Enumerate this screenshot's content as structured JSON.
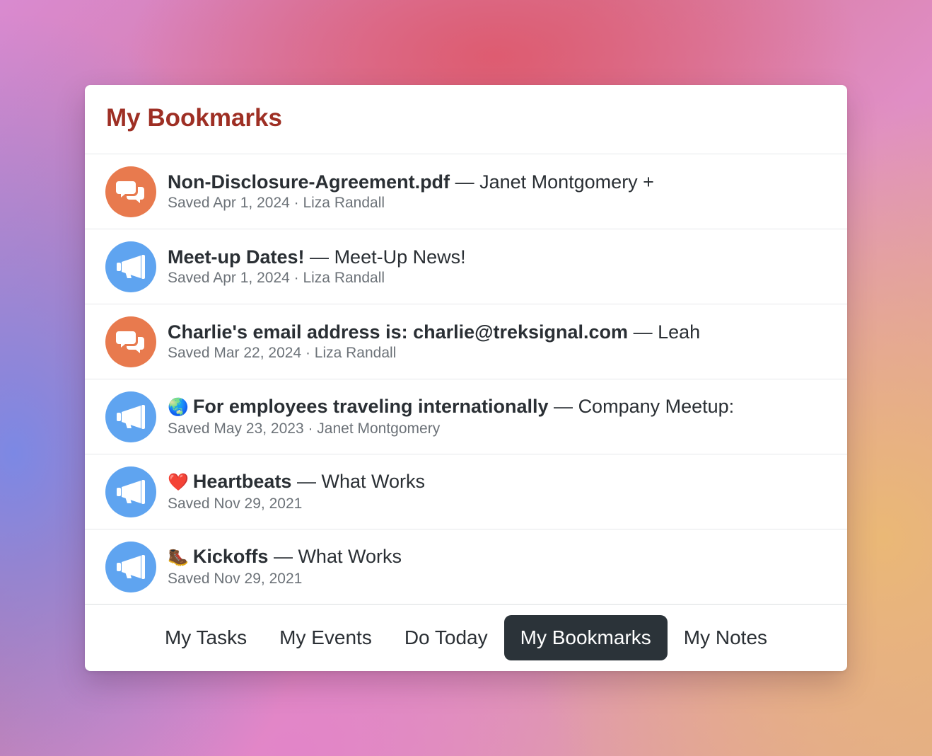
{
  "panel": {
    "title": "My Bookmarks"
  },
  "bookmarks": [
    {
      "icon": "chat-bubbles-icon",
      "emoji": "",
      "title": "Non-Disclosure-Agreement.pdf",
      "separator": "—",
      "source": "Janet Montgomery +",
      "meta": "Saved Apr 1, 2024 · Liza Randall"
    },
    {
      "icon": "megaphone-icon",
      "emoji": "",
      "title": "Meet-up Dates!",
      "separator": "—",
      "source": "Meet-Up News!",
      "meta": "Saved Apr 1, 2024 · Liza Randall"
    },
    {
      "icon": "chat-bubbles-icon",
      "emoji": "",
      "title": "Charlie's email address is: charlie@treksignal.com",
      "separator": "—",
      "source": "Leah",
      "meta": "Saved Mar 22, 2024 · Liza Randall"
    },
    {
      "icon": "megaphone-icon",
      "emoji": "🌏",
      "title": "For employees traveling internationally",
      "separator": "—",
      "source": "Company Meetup:",
      "meta": "Saved May 23, 2023 · Janet Montgomery"
    },
    {
      "icon": "megaphone-icon",
      "emoji": "❤️",
      "title": "Heartbeats",
      "separator": "—",
      "source": "What Works",
      "meta": "Saved Nov 29, 2021"
    },
    {
      "icon": "megaphone-icon",
      "emoji": "🥾",
      "title": "Kickoffs",
      "separator": "—",
      "source": "What Works",
      "meta": "Saved Nov 29, 2021"
    }
  ],
  "tabs": [
    {
      "label": "My Tasks",
      "active": false
    },
    {
      "label": "My Events",
      "active": false
    },
    {
      "label": "Do Today",
      "active": false
    },
    {
      "label": "My Bookmarks",
      "active": true
    },
    {
      "label": "My Notes",
      "active": false
    }
  ],
  "colors": {
    "title": "#9e2f24",
    "chat_avatar": "#e87a4e",
    "announce_avatar": "#5fa4f0",
    "active_tab": "#2b3339"
  }
}
